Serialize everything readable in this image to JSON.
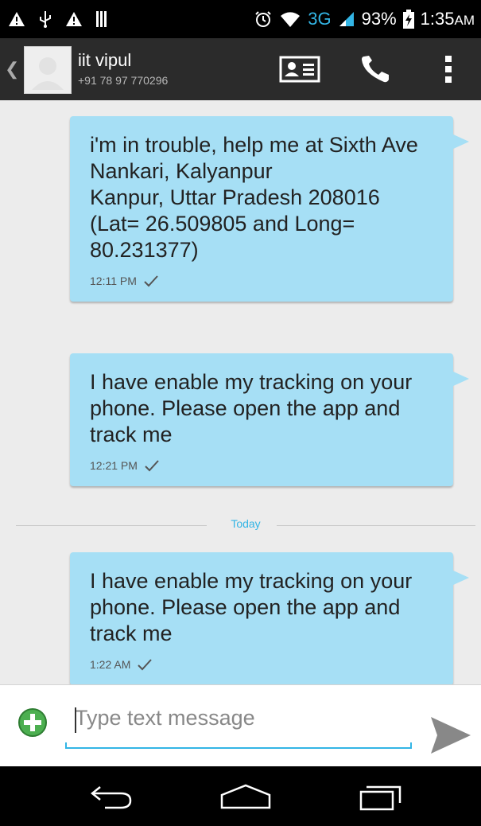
{
  "status_bar": {
    "left_icons": [
      "warning-icon",
      "usb-icon",
      "warning-icon",
      "sd-card-icon"
    ],
    "network": "3G",
    "battery": "93%",
    "time": "1:35",
    "ampm": "AM"
  },
  "header": {
    "name": "iit vipul",
    "number": "+91 78 97 770296"
  },
  "messages": [
    {
      "text": "i'm in trouble, help me at Sixth Ave\nNankari, Kalyanpur\nKanpur, Uttar Pradesh 208016\n(Lat= 26.509805 and Long= 80.231377)",
      "time": "12:11 PM"
    },
    {
      "text": "I have enable my tracking on your phone. Please open the app and track me",
      "time": "12:21 PM"
    },
    {
      "text": "I have enable my tracking on your phone. Please open the app and track me",
      "time": "1:22 AM"
    }
  ],
  "divider": {
    "label": "Today"
  },
  "compose": {
    "placeholder": "Type text message"
  },
  "colors": {
    "accent": "#33b5e5",
    "bubble": "#a6dff5",
    "add_button": "#4caf50"
  }
}
